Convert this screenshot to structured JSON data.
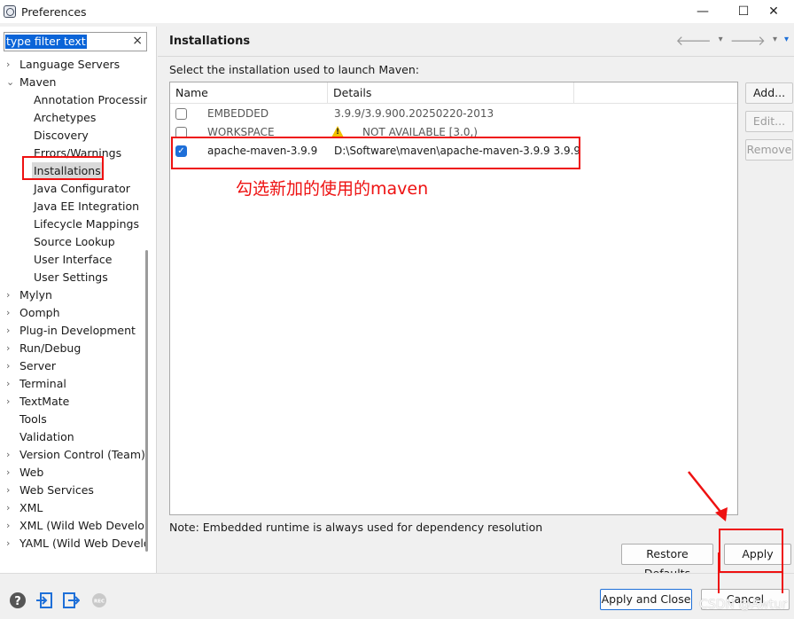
{
  "window": {
    "title": "Preferences",
    "minimize": "—",
    "maximize": "☐",
    "close": "✕"
  },
  "filter": {
    "value": "type filter text",
    "clear": "×"
  },
  "tree": [
    {
      "label": "Language Servers",
      "level": 0,
      "expander": "›"
    },
    {
      "label": "Maven",
      "level": 0,
      "expander": "⌄"
    },
    {
      "label": "Annotation Processing",
      "level": 1
    },
    {
      "label": "Archetypes",
      "level": 1
    },
    {
      "label": "Discovery",
      "level": 1
    },
    {
      "label": "Errors/Warnings",
      "level": 1
    },
    {
      "label": "Installations",
      "level": 1,
      "selected": true
    },
    {
      "label": "Java Configurator",
      "level": 1
    },
    {
      "label": "Java EE Integration",
      "level": 1
    },
    {
      "label": "Lifecycle Mappings",
      "level": 1
    },
    {
      "label": "Source Lookup",
      "level": 1
    },
    {
      "label": "User Interface",
      "level": 1
    },
    {
      "label": "User Settings",
      "level": 1
    },
    {
      "label": "Mylyn",
      "level": 0,
      "expander": "›"
    },
    {
      "label": "Oomph",
      "level": 0,
      "expander": "›"
    },
    {
      "label": "Plug-in Development",
      "level": 0,
      "expander": "›"
    },
    {
      "label": "Run/Debug",
      "level": 0,
      "expander": "›"
    },
    {
      "label": "Server",
      "level": 0,
      "expander": "›"
    },
    {
      "label": "Terminal",
      "level": 0,
      "expander": "›"
    },
    {
      "label": "TextMate",
      "level": 0,
      "expander": "›"
    },
    {
      "label": "Tools",
      "level": 0
    },
    {
      "label": "Validation",
      "level": 0
    },
    {
      "label": "Version Control (Team)",
      "level": 0,
      "expander": "›"
    },
    {
      "label": "Web",
      "level": 0,
      "expander": "›"
    },
    {
      "label": "Web Services",
      "level": 0,
      "expander": "›"
    },
    {
      "label": "XML",
      "level": 0,
      "expander": "›"
    },
    {
      "label": "XML (Wild Web Developer)",
      "level": 0,
      "expander": "›"
    },
    {
      "label": "YAML (Wild Web Developer)",
      "level": 0,
      "expander": "›"
    }
  ],
  "page": {
    "title": "Installations",
    "back_icon": "🡐",
    "forward_icon": "🡒",
    "dropdown_icon": "▾",
    "select_label": "Select the installation used to launch Maven:",
    "columns": {
      "name": "Name",
      "details": "Details"
    },
    "rows": [
      {
        "checked": false,
        "name": "EMBEDDED",
        "details": "3.9.9/3.9.900.20250220-2013"
      },
      {
        "checked": false,
        "name": "WORKSPACE",
        "details": "NOT AVAILABLE [3.0,)",
        "warning": true
      },
      {
        "checked": true,
        "name": "apache-maven-3.9.9",
        "details": "D:\\Software\\maven\\apache-maven-3.9.9 3.9.9"
      }
    ],
    "buttons": {
      "add": "Add...",
      "edit": "Edit...",
      "remove": "Remove"
    },
    "note": "Note: Embedded runtime is always used for dependency resolution",
    "restore_defaults": "Restore Defaults",
    "apply": "Apply"
  },
  "annotation": {
    "text": "勾选新加的使用的maven",
    "color": "#ee1111"
  },
  "footer": {
    "apply_and_close": "Apply and Close",
    "cancel": "Cancel",
    "watermark": "CSDN @Awtur"
  },
  "colors": {
    "accent": "#1e6fd8",
    "annotation": "#ee1111",
    "selection": "#0a64d8"
  }
}
